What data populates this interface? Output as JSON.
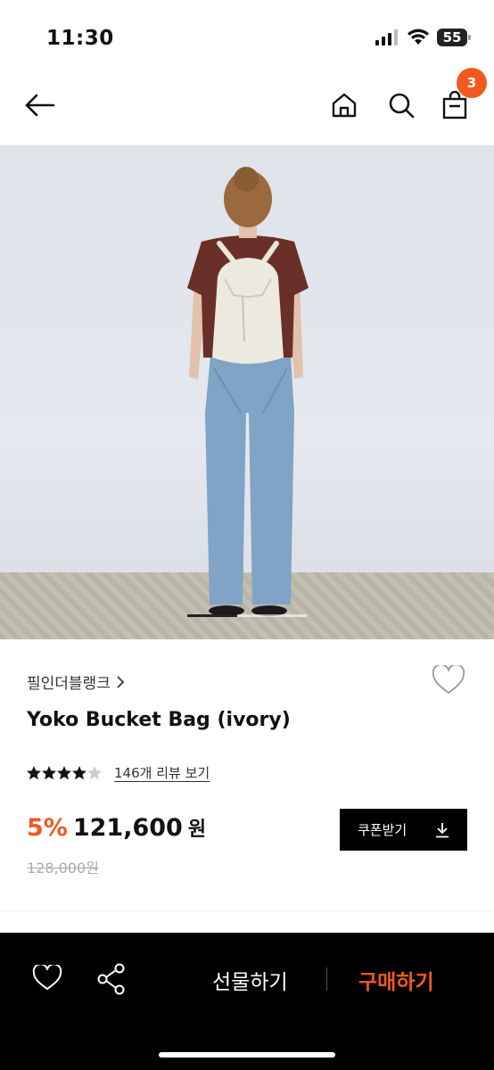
{
  "status_bar": {
    "time": "11:30",
    "battery": "55"
  },
  "nav": {
    "cart_count": "3"
  },
  "product": {
    "brand": "필인더블랭크",
    "name": "Yoko Bucket Bag (ivory)",
    "rating_stars": 4.5,
    "review_link": "146개 리뷰 보기",
    "discount": "5%",
    "price": "121,600",
    "price_unit": "원",
    "original_price": "128,000원"
  },
  "coupon": {
    "label": "쿠폰받기"
  },
  "bottom_bar": {
    "gift_label": "선물하기",
    "buy_label": "구매하기"
  },
  "colors": {
    "accent": "#f05a1e",
    "dark": "#000000"
  }
}
